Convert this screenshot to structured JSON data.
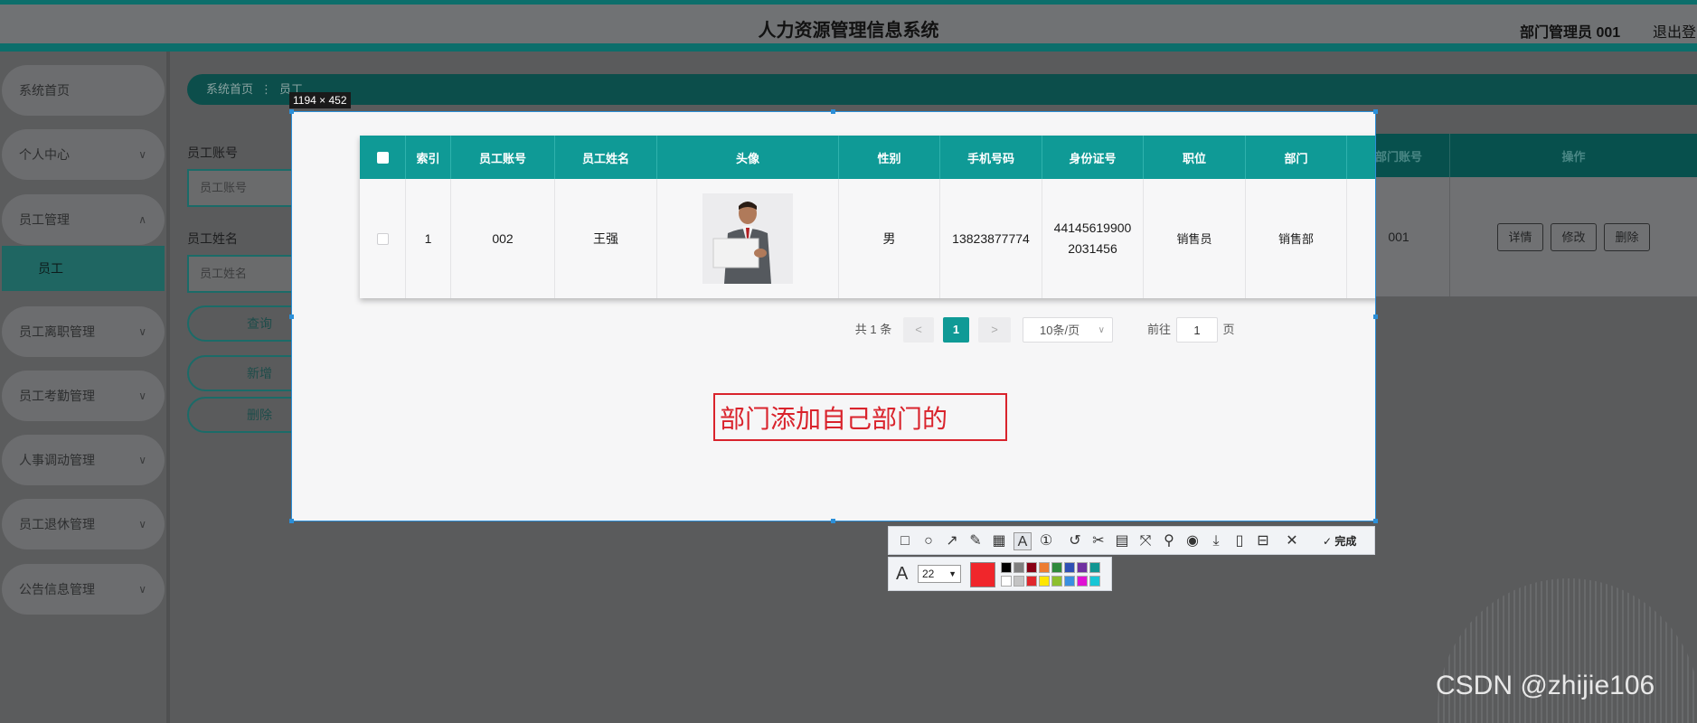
{
  "header": {
    "title": "人力资源管理信息系统",
    "user": "部门管理员 001",
    "logout": "退出登录"
  },
  "sidebar": {
    "items": [
      {
        "label": "系统首页"
      },
      {
        "label": "个人中心"
      },
      {
        "label": "员工管理"
      },
      {
        "label": "员工"
      },
      {
        "label": "员工离职管理"
      },
      {
        "label": "员工考勤管理"
      },
      {
        "label": "人事调动管理"
      },
      {
        "label": "员工退休管理"
      },
      {
        "label": "公告信息管理"
      }
    ]
  },
  "breadcrumb": {
    "home": "系统首页",
    "separator": "⋮",
    "current": "员工"
  },
  "search": {
    "account_label": "员工账号",
    "account_placeholder": "员工账号",
    "name_label": "员工姓名",
    "name_placeholder": "员工姓名",
    "query_btn": "查询",
    "add_btn": "新增",
    "delete_btn": "删除"
  },
  "table": {
    "columns": [
      "索引",
      "员工账号",
      "员工姓名",
      "头像",
      "性别",
      "手机号码",
      "身份证号",
      "职位",
      "部门",
      "部门账号",
      "操作"
    ],
    "rows": [
      {
        "index": "1",
        "account": "002",
        "name": "王强",
        "gender": "男",
        "phone": "13823877774",
        "id_line1": "44145619900",
        "id_line2": "2031456",
        "position": "销售员",
        "dept": "销售部",
        "dept_account": "001",
        "ops": [
          "详情",
          "修改",
          "删除"
        ]
      }
    ]
  },
  "pagination": {
    "total": "共 1 条",
    "prev": "<",
    "current_page": "1",
    "next": ">",
    "page_size": "10条/页",
    "goto_label": "前往",
    "goto_value": "1",
    "page_suffix": "页"
  },
  "capture": {
    "size": "1194 × 452",
    "annotation": "部门添加自己部门的",
    "done": "完成",
    "font_size": "22",
    "current_color": "#f0262b",
    "palette_top": [
      "#000000",
      "#7f7f7f",
      "#880015",
      "#ed7d31",
      "#2f8a3c",
      "#2e4fb4",
      "#7030a0",
      "#109592"
    ],
    "palette_bottom": [
      "#ffffff",
      "#c3c3c3",
      "#e0282d",
      "#ffe600",
      "#8dbf2e",
      "#3a8fe0",
      "#e012d4",
      "#18c6d6"
    ]
  },
  "watermark": "CSDN @zhijie106"
}
